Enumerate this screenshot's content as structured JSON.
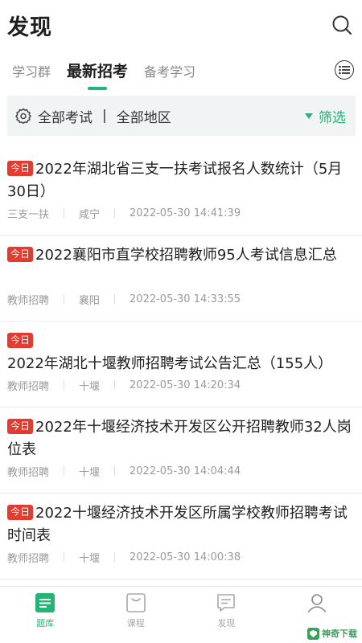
{
  "header": {
    "title": "发现"
  },
  "tabs": [
    {
      "label": "学习群",
      "active": false
    },
    {
      "label": "最新招考",
      "active": true
    },
    {
      "label": "备考学习",
      "active": false
    }
  ],
  "filter": {
    "exam": "全部考试",
    "separator": "|",
    "region": "全部地区",
    "filter_label": "筛选"
  },
  "feed": [
    {
      "badge": "今日",
      "title": "2022年湖北省三支一扶考试报名人数统计（5月30日）",
      "category": "三支一扶",
      "region": "咸宁",
      "time": "2022-05-30 14:41:39"
    },
    {
      "badge": "今日",
      "title": "2022襄阳市直学校招聘教师95人考试信息汇总",
      "category": "教师招聘",
      "region": "襄阳",
      "time": "2022-05-30 14:33:55"
    },
    {
      "badge": "今日",
      "title": "2022年湖北十堰教师招聘考试公告汇总（155人）",
      "category": "教师招聘",
      "region": "十堰",
      "time": "2022-05-30 14:20:34"
    },
    {
      "badge": "今日",
      "title": "2022年十堰经济技术开发区公开招聘教师32人岗位表",
      "category": "教师招聘",
      "region": "十堰",
      "time": "2022-05-30 14:04:44"
    },
    {
      "badge": "今日",
      "title": "2022十堰经济技术开发区所属学校教师招聘考试时间表",
      "category": "教师招聘",
      "region": "十堰",
      "time": "2022-05-30 14:00:38"
    }
  ],
  "bottom_nav": [
    {
      "label": "题库",
      "icon": "question-bank-icon",
      "active": true
    },
    {
      "label": "课程",
      "icon": "course-bag-icon",
      "active": false
    },
    {
      "label": "发现",
      "icon": "discover-chat-icon",
      "active": false
    },
    {
      "label": "",
      "icon": "profile-icon",
      "active": false
    }
  ],
  "watermark": {
    "text": "神奇下载"
  },
  "colors": {
    "accent": "#22b573",
    "badge": "#e23b2f",
    "filter_bg": "#f0f4f5"
  }
}
